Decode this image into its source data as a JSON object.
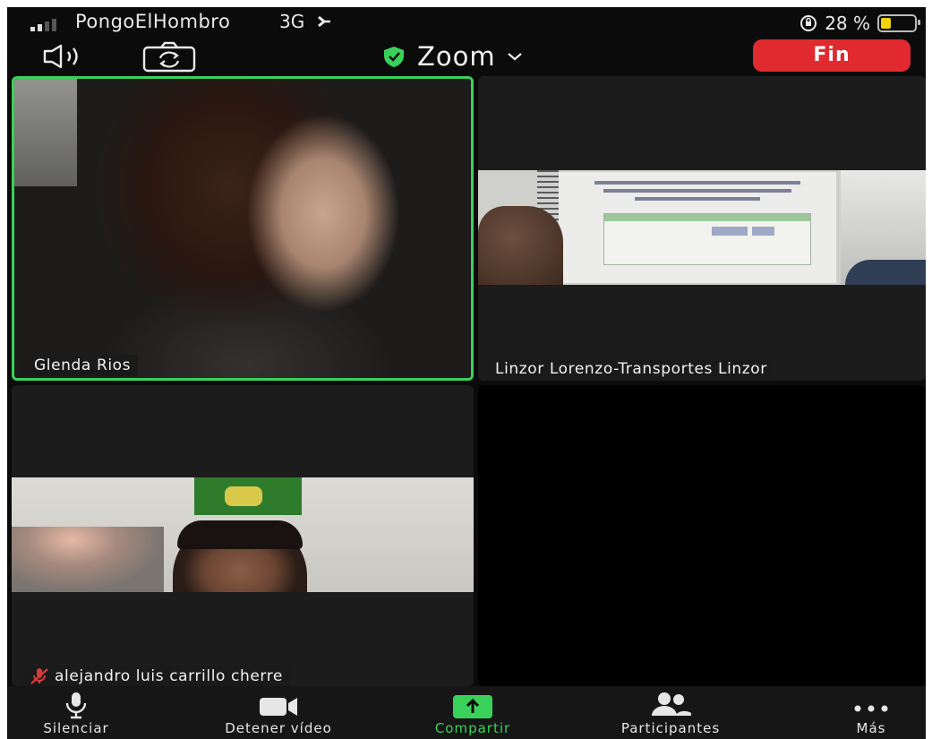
{
  "status_bar": {
    "carrier": "PongoElHombro",
    "network": "3G",
    "battery_percent": "28 %",
    "battery_level": 0.28,
    "battery_color": "#f2d20c"
  },
  "top_bar": {
    "speaker_icon": "speaker-icon",
    "camera_switch_icon": "camera-switch-icon",
    "title": "Zoom",
    "shield_icon": "shield-check-icon",
    "end_button": "Fin",
    "end_button_color": "#e02a2f"
  },
  "participants": [
    {
      "name": "Glenda Rios",
      "active_speaker": true
    },
    {
      "name": "Linzor Lorenzo-Transportes Linzor",
      "active_speaker": false
    },
    {
      "name": "alejandro luis carrillo cherre",
      "muted": true
    }
  ],
  "toolbar": {
    "mute_label": "Silenciar",
    "stop_video_label": "Detener vídeo",
    "share_label": "Compartir",
    "participants_label": "Participantes",
    "more_label": "Más",
    "share_color": "#3ad15a"
  },
  "colors": {
    "active_border": "#3ad15a"
  }
}
